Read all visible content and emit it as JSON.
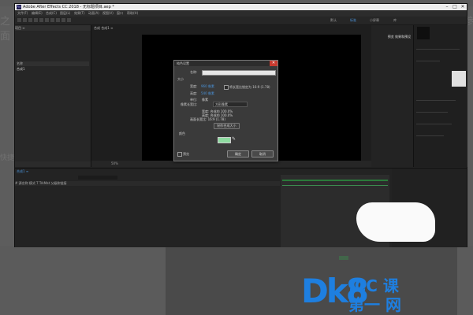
{
  "background": {
    "left_text": "之面",
    "left_text2": "快捷",
    "right_text": "参"
  },
  "window": {
    "title": "Adobe After Effects CC 2018 - 无标题项目.aep *",
    "logo": "Ae",
    "controls": [
      "–",
      "□",
      "✕"
    ]
  },
  "menubar": [
    "文件(F)",
    "编辑(E)",
    "合成(C)",
    "图层(L)",
    "效果(T)",
    "动画(A)",
    "视图(V)",
    "窗口",
    "帮助(H)"
  ],
  "toolbar": {
    "workspaces": [
      {
        "label": "默认",
        "active": false
      },
      {
        "label": "标准",
        "active": true
      },
      {
        "label": "小屏幕",
        "active": false
      },
      {
        "label": "库",
        "active": false
      }
    ]
  },
  "project_panel": {
    "tab": "项目 ≡",
    "list_header": "名称",
    "row": "合成1"
  },
  "viewer": {
    "tab": "合成 合成1 ≡",
    "footer": "50%"
  },
  "info_panel": {
    "label": "预览 效果和预设"
  },
  "timeline": {
    "tab": "合成1 ≡",
    "header": "#  源名称              模式   T  TrkMat   父级和链接"
  },
  "dialog": {
    "title": "纯色设置",
    "name_label": "名称:",
    "name_value": "",
    "size_label": "大小",
    "width_label": "宽度:",
    "width_value": "960 像素",
    "height_label": "高度:",
    "height_value": "540 像素",
    "lock_label": "将长宽比锁定为 16:9 (1.78)",
    "units_label": "单位:",
    "units_value": "像素",
    "par_label": "像素长宽比:",
    "par_value": "方形像素",
    "info_width": "宽度: 合成的 100.0%",
    "info_height": "高度: 合成的 100.0%",
    "info_frame": "画面长宽比: 16:9 (1.78)",
    "make_comp_size": "制作合成大小",
    "color_label": "颜色",
    "swatch_color": "#8edba0",
    "preview_label": "预览",
    "ok": "确定",
    "cancel": "取消"
  },
  "watermark": {
    "logo": "Dk8",
    "line1": ".CC 课",
    "line2": "第一 网"
  }
}
